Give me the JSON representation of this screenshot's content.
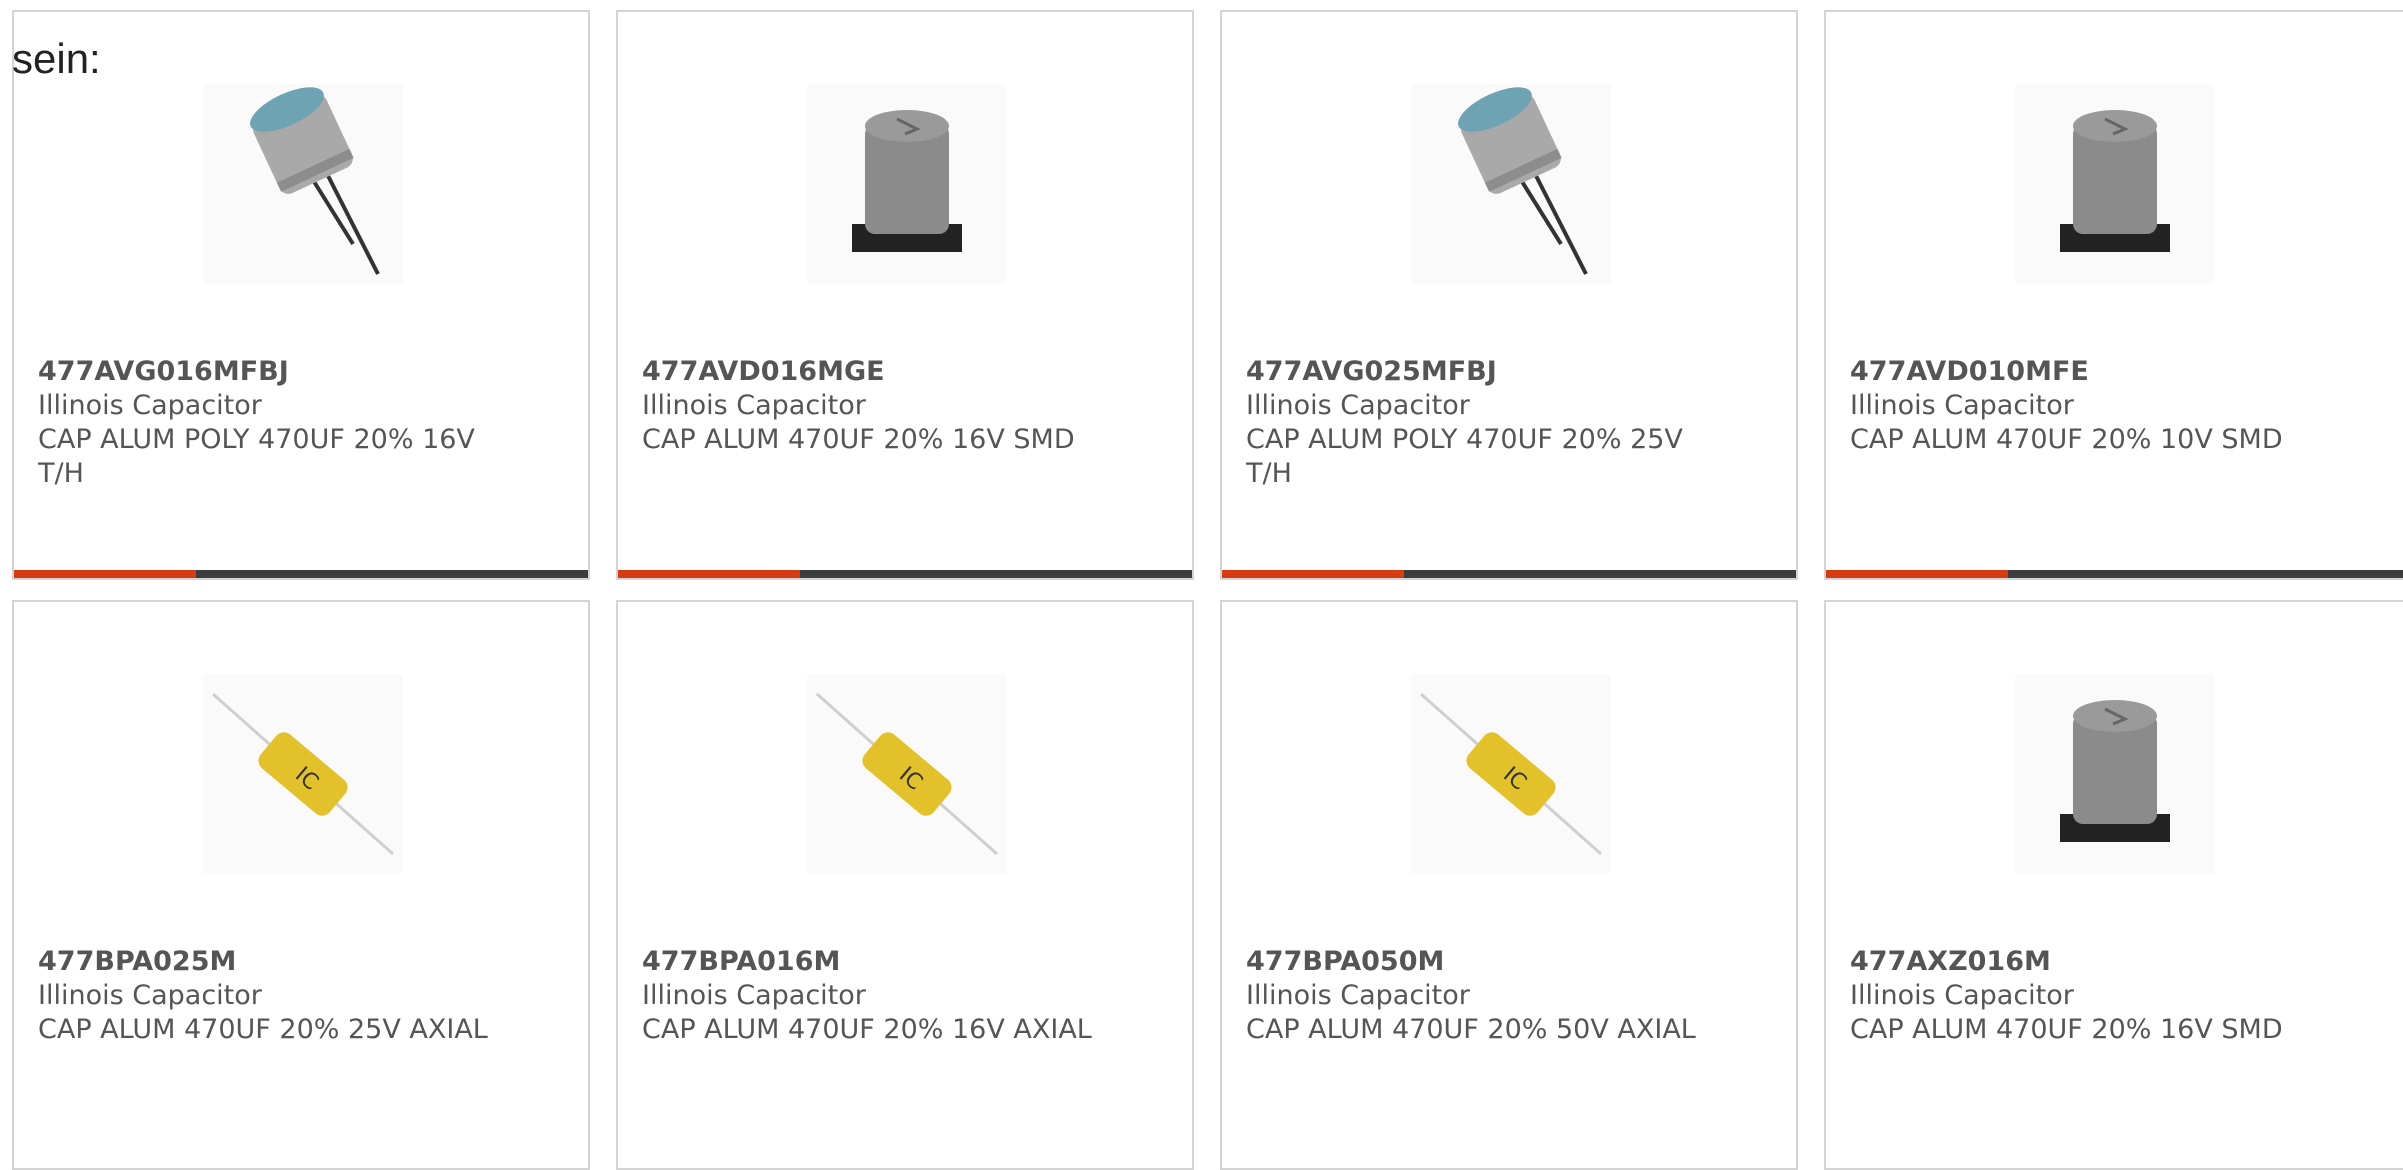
{
  "lead_text": "sein:",
  "cards": [
    {
      "part": "477AVG016MFBJ",
      "maker": "Illinois Capacitor",
      "desc1": "CAP ALUM POLY 470UF 20% 16V",
      "desc2": "T/H",
      "image": "radial-capacitor-icon"
    },
    {
      "part": "477AVD016MGE",
      "maker": "Illinois Capacitor",
      "desc1": "CAP ALUM 470UF 20% 16V SMD",
      "desc2": "",
      "image": "smd-capacitor-icon"
    },
    {
      "part": "477AVG025MFBJ",
      "maker": "Illinois Capacitor",
      "desc1": "CAP ALUM POLY 470UF 20% 25V",
      "desc2": "T/H",
      "image": "radial-capacitor-icon"
    },
    {
      "part": "477AVD010MFE",
      "maker": "Illinois Capacitor",
      "desc1": "CAP ALUM 470UF 20% 10V SMD",
      "desc2": "",
      "image": "smd-capacitor-icon"
    },
    {
      "part": "477BPA025M",
      "maker": "Illinois Capacitor",
      "desc1": "CAP ALUM 470UF 20% 25V AXIAL",
      "desc2": "",
      "image": "axial-capacitor-icon"
    },
    {
      "part": "477BPA016M",
      "maker": "Illinois Capacitor",
      "desc1": "CAP ALUM 470UF 20% 16V AXIAL",
      "desc2": "",
      "image": "axial-capacitor-icon"
    },
    {
      "part": "477BPA050M",
      "maker": "Illinois Capacitor",
      "desc1": "CAP ALUM 470UF 20% 50V AXIAL",
      "desc2": "",
      "image": "axial-capacitor-icon"
    },
    {
      "part": "477AXZ016M",
      "maker": "Illinois Capacitor",
      "desc1": "CAP ALUM 470UF 20% 16V SMD",
      "desc2": "",
      "image": "smd-capacitor-icon"
    }
  ],
  "colors": {
    "accent": "#d63b12",
    "bar": "#3d3d3d",
    "text": "#555555",
    "border": "#d4d4d4"
  }
}
